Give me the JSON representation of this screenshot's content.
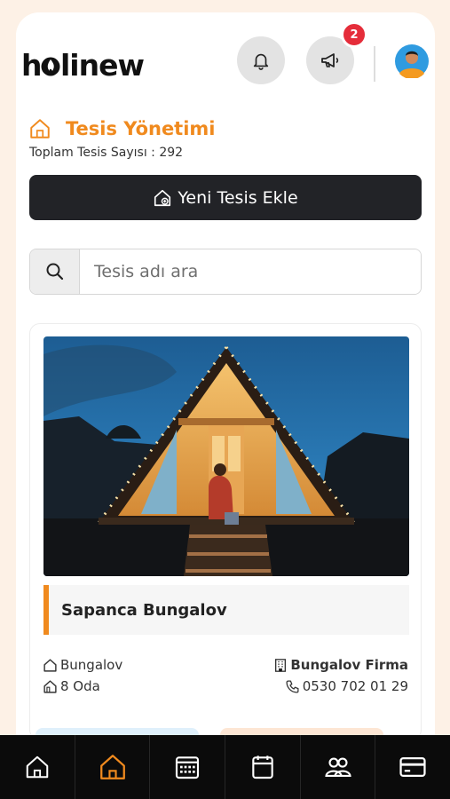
{
  "header": {
    "logo_text": "hlinew",
    "notification_badge": "2"
  },
  "page": {
    "title": "Tesis Yönetimi",
    "total_label": "Toplam Tesis Sayısı : 292"
  },
  "actions": {
    "add_label": "Yeni Tesis Ekle"
  },
  "search": {
    "placeholder": "Tesis adı ara",
    "value": ""
  },
  "facility": {
    "name": "Sapanca Bungalov",
    "type": "Bungalov",
    "rooms": "8 Oda",
    "company": "Bungalov Firma",
    "phone": "0530 702 01 29"
  },
  "tabbar": {
    "items": [
      "home-outline-icon",
      "home-active-icon",
      "calendar-icon",
      "wallet-icon",
      "users-icon",
      "credit-card-icon"
    ],
    "active_color": "#f08a1e"
  },
  "colors": {
    "accent": "#f08a1e",
    "dark": "#222327",
    "badge": "#e52d3a"
  }
}
